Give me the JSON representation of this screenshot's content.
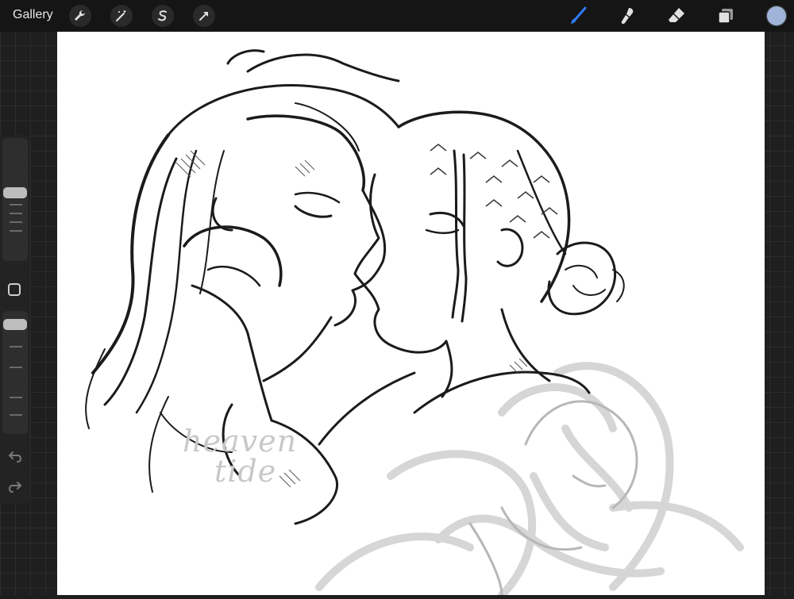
{
  "topbar": {
    "gallery_label": "Gallery",
    "left_tools": [
      "wrench-icon",
      "magic-wand-icon",
      "selection-icon",
      "transform-arrow-icon"
    ],
    "right_tools": [
      "brush-icon",
      "smudge-icon",
      "eraser-icon",
      "layers-icon"
    ],
    "active_tool": "brush-icon",
    "current_color": "#9fb4d8",
    "brush_accent": "#2f7bf6"
  },
  "canvas": {
    "watermark_line1": "heaven",
    "watermark_line2": "tide"
  },
  "sidebar": {
    "brush_size_slider": "brush-size-slider",
    "opacity_slider": "brush-opacity-slider",
    "modify_button": "modify-square-icon",
    "undo": "undo-icon",
    "redo": "redo-icon"
  }
}
